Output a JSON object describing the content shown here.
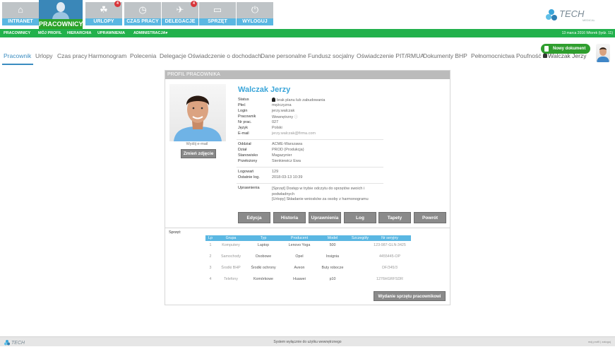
{
  "nav": {
    "tiles": [
      {
        "label": "INTRANET",
        "icon": "home-icon",
        "glyph": "⌂",
        "badge": ""
      },
      {
        "label": "PRACOWNICY",
        "icon": "employee-icon",
        "glyph": "",
        "badge": ""
      },
      {
        "label": "URLOPY",
        "icon": "palm-tree-icon",
        "glyph": "☘",
        "badge": "4"
      },
      {
        "label": "CZAS PRACY",
        "icon": "clock-icon",
        "glyph": "◷",
        "badge": ""
      },
      {
        "label": "DELEGACJE",
        "icon": "airplane-icon",
        "glyph": "✈",
        "badge": "4"
      },
      {
        "label": "SPRZĘT",
        "icon": "monitor-icon",
        "glyph": "▭",
        "badge": ""
      },
      {
        "label": "WYLOGUJ",
        "icon": "power-icon",
        "glyph": "⏻",
        "badge": ""
      }
    ]
  },
  "brand": {
    "name": "TECH",
    "sub": "MEDICAL"
  },
  "subnav": {
    "items": [
      "PRACOWNICY",
      "MÓJ PROFIL",
      "HIERARCHIA",
      "UPRAWNIENIA",
      "ADMINISTRACJA▾"
    ],
    "date": "13 marca 2016 Wtorek (tydz. 11)"
  },
  "tabs": [
    "Pracownik",
    "Urlopy",
    "Czas pracy",
    "Harmonogram",
    "Polecenia",
    "Delegacje",
    "Oświadczenie o dochodach",
    "Dane personalne",
    "Fundusz socjalny",
    "Oświadczenie PIT/RMUA",
    "Dokumenty BHP",
    "Pełnomocnictwa",
    "Poufność"
  ],
  "user": {
    "name": "Walczak Jerzy"
  },
  "new_doc_label": "Nowy dokument",
  "panel": {
    "title": "PROFIL PRACOWNIKA",
    "send_email": "Wyślij e-mail",
    "change_photo": "Zmień zdjęcie",
    "name": "Walczak Jerzy",
    "fields1": [
      {
        "label": "Status",
        "value": "brak planu lub zabudowania"
      },
      {
        "label": "Płeć",
        "value": "mężczyzna"
      },
      {
        "label": "Login",
        "value": "jerzy.walczak"
      },
      {
        "label": "Pracownik",
        "value": "Wewnętrzny"
      },
      {
        "label": "Nr prac.",
        "value": "027"
      },
      {
        "label": "Język",
        "value": "Polski"
      },
      {
        "label": "E-mail",
        "value": "jerzy.walczak@firma.com"
      }
    ],
    "fields2": [
      {
        "label": "Oddział",
        "value": "ACME-Warszawa"
      },
      {
        "label": "Dział",
        "value": "PROD (Produkcja)"
      },
      {
        "label": "Stanowisko",
        "value": "Magazynier"
      },
      {
        "label": "Przełożony",
        "value": "Sienkiewicz Ewa"
      }
    ],
    "fields3": [
      {
        "label": "Logowań",
        "value": "129"
      },
      {
        "label": "Ostatnie log.",
        "value": "2018-03-13 10:39"
      }
    ],
    "permissions": {
      "label": "Uprawnienia",
      "lines": [
        "[Sprzęt] Dostęp w trybie odczytu do sprzętów swoich i podwładnych",
        "[Urlopy] Składanie wniosków za osoby z harmonogramu"
      ]
    },
    "buttons": [
      "Edycja",
      "Historia",
      "Uprawnienia",
      "Log",
      "Tapety",
      "Powrót"
    ]
  },
  "equipment": {
    "label": "Sprzęt",
    "columns": [
      "Lp",
      "Grupa",
      "Typ",
      "Producent",
      "Model",
      "Szczegóły",
      "Nr seryjny"
    ],
    "rows": [
      [
        "1",
        "Komputery",
        "Laptop",
        "Lenovo Yoga",
        "500",
        "",
        "123-987-GLN-3425"
      ],
      [
        "2",
        "Samochody",
        "Osobowe",
        "Opel",
        "Insignia",
        "",
        "4455445-OP"
      ],
      [
        "3",
        "Środki BHP",
        "Środki ochrony",
        "Aveon",
        "Buty robocze",
        "",
        "DF/345/3"
      ],
      [
        "4",
        "Telefony",
        "Komórkowe",
        "Huawei",
        "p10",
        "",
        "1276HGRFSDR"
      ]
    ],
    "issue_button": "Wydanie sprzętu pracownikowi"
  },
  "footer": {
    "text": "System wyłącznie do użytku wewnętrznego",
    "right": "mój profil | zaloguj"
  }
}
